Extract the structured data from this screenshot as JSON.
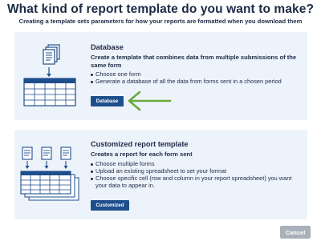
{
  "header": {
    "title": "What kind of report template do you want to make?",
    "subtitle": "Creating a template sets parameters for how your reports are formatted when you download them"
  },
  "cards": [
    {
      "heading": "Database",
      "description": "Create a template that combines data from multiple submissions of the same form",
      "bullets": [
        "Choose one form",
        "Generate a database of all the data from forms sent in a chosen period"
      ],
      "button_label": "Database",
      "illustration_icon": "stacked-forms-to-database-icon",
      "pointer_icon": "arrow-left-icon",
      "pointer_color": "#6aaa3a"
    },
    {
      "heading": "Customized report template",
      "description": "Creates a report for each form sent",
      "bullets": [
        "Choose multiple forms",
        "Upload an existing spreadsheet to set your format",
        "Choose specific cell (row and column in your report spreadsheet) you want your data to appear in."
      ],
      "button_label": "Customized",
      "illustration_icon": "multiple-forms-to-spreadsheet-icon"
    }
  ],
  "footer": {
    "cancel_label": "Cancel"
  },
  "colors": {
    "text": "#1c2a46",
    "card_bg": "#edf3fa",
    "primary_button": "#1f4e8c",
    "cancel_button": "#a9b0ba",
    "arrow": "#6aaa3a"
  }
}
